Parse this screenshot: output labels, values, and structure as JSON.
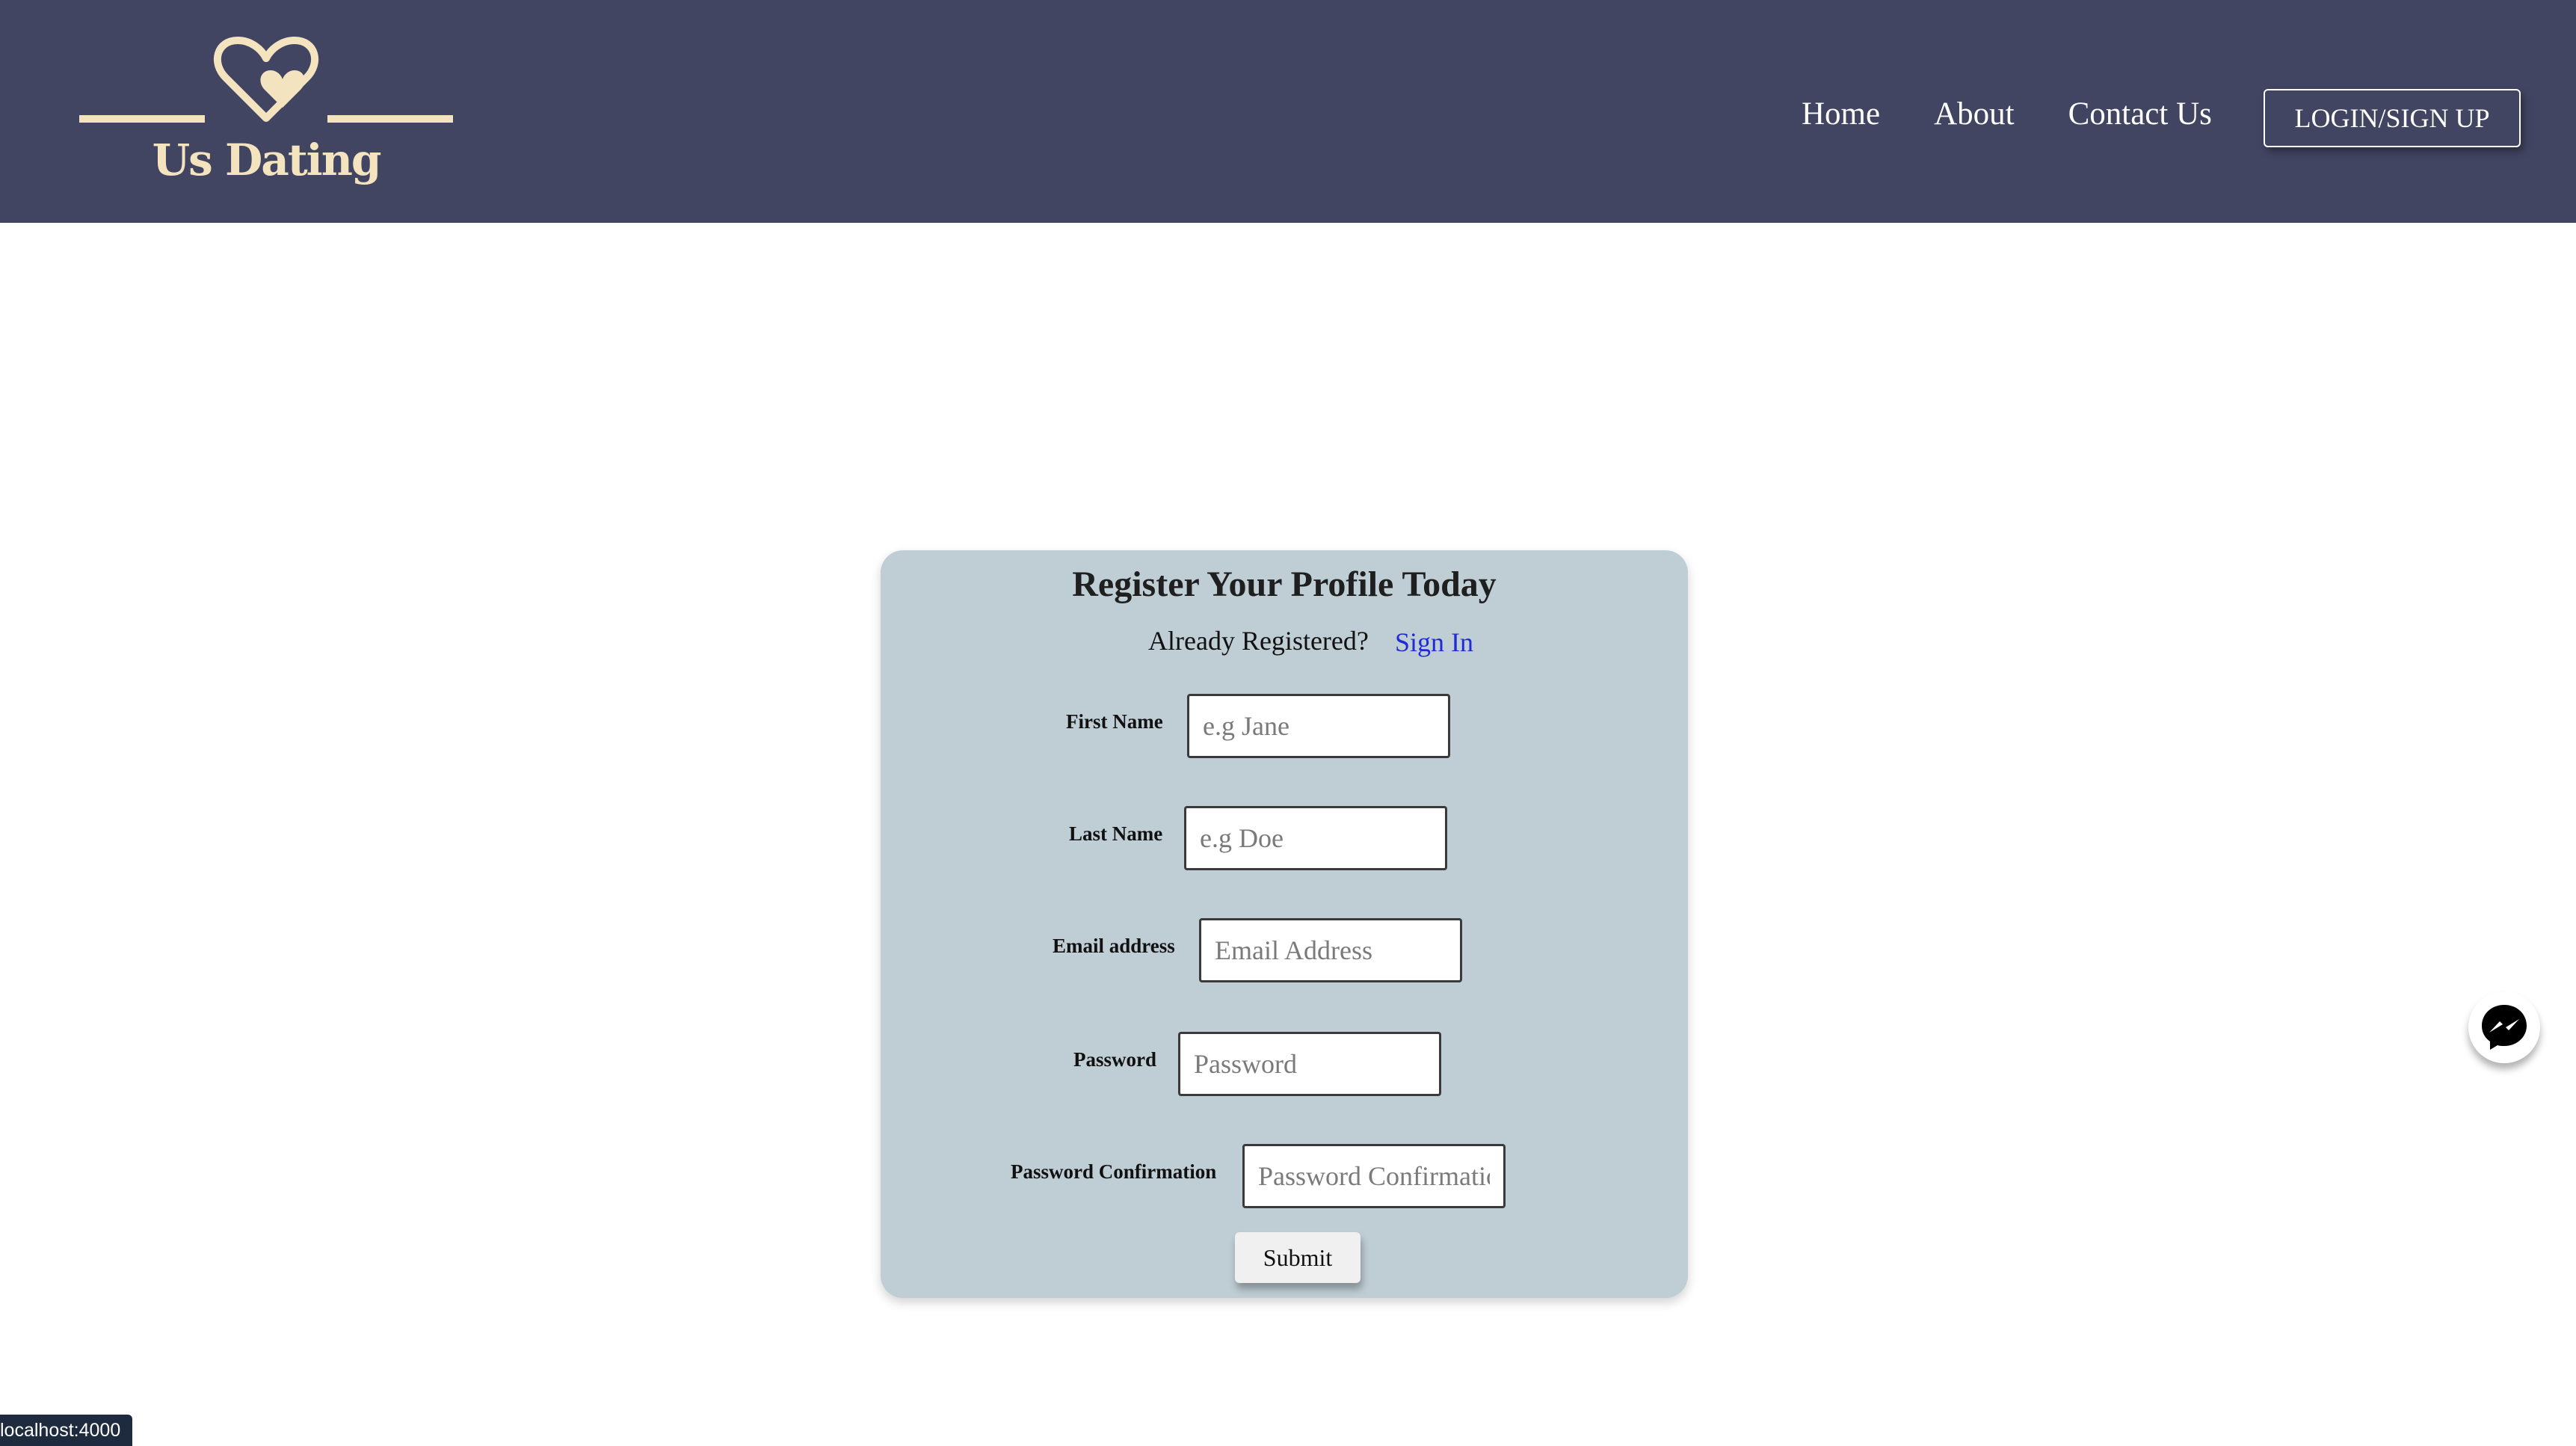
{
  "brand": {
    "name": "Us Dating",
    "logo_icon": "heart-icon",
    "color": "#f3e3be"
  },
  "nav": {
    "items": [
      {
        "label": "Home"
      },
      {
        "label": "About"
      },
      {
        "label": "Contact Us"
      }
    ],
    "login_label": "LOGIN/SIGN UP",
    "background": "#414562"
  },
  "form": {
    "title": "Register Your Profile Today",
    "already_text": "Already Registered?",
    "signin_label": "Sign In",
    "fields": [
      {
        "label": "First Name",
        "placeholder": "e.g Jane",
        "value": ""
      },
      {
        "label": "Last Name",
        "placeholder": "e.g Doe",
        "value": ""
      },
      {
        "label": "Email address",
        "placeholder": "Email Address",
        "value": ""
      },
      {
        "label": "Password",
        "placeholder": "Password",
        "value": ""
      },
      {
        "label": "Password Confirmation",
        "placeholder": "Password Confirmation",
        "value": ""
      }
    ],
    "submit_label": "Submit",
    "card_color": "#bfcdd4"
  },
  "chat_widget": {
    "icon": "messenger-icon"
  },
  "status_bar": {
    "url": "localhost:4000"
  }
}
